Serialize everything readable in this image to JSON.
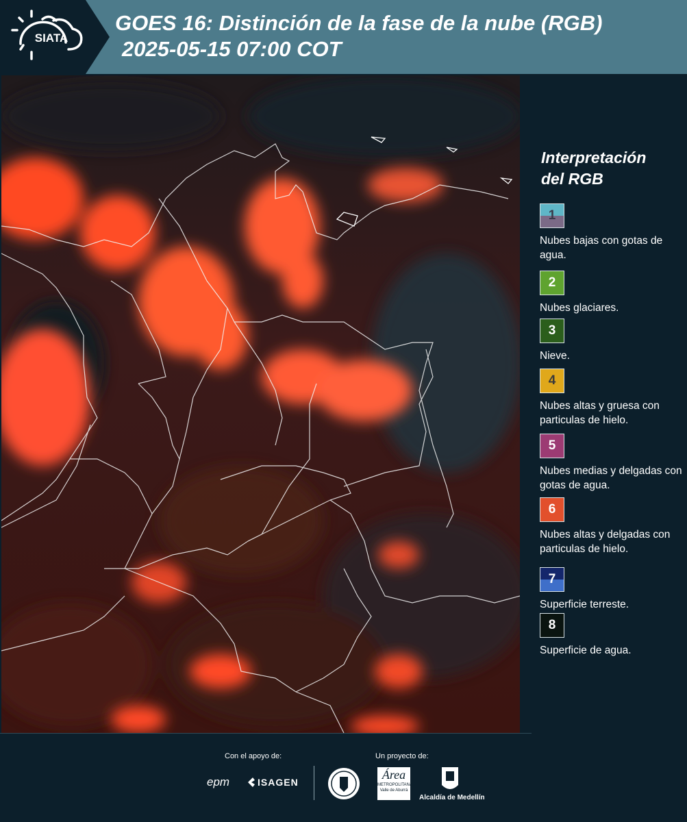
{
  "header": {
    "logo_text": "SIATA",
    "title_line1": "GOES 16: Distinción de la fase de la nube (RGB)",
    "title_line2": "2025-05-15 07:00 COT"
  },
  "legend": {
    "title_line1": "Interpretación",
    "title_line2": "del RGB",
    "items": [
      {
        "num": "1",
        "label": "Nubes bajas con gotas de agua.",
        "color_top": "#5fb6c7",
        "color_bottom": "#7b6a87",
        "text_color": "#3a3a4a"
      },
      {
        "num": "2",
        "label": "Nubes glaciares.",
        "color_top": "#5fa32f",
        "color_bottom": "#5fa32f",
        "text_color": "#ffffff"
      },
      {
        "num": "3",
        "label": "Nieve.",
        "color_top": "#2b5e1c",
        "color_bottom": "#2b5e1c",
        "text_color": "#ffffff"
      },
      {
        "num": "4",
        "label": "Nubes altas y gruesa con particulas de hielo.",
        "color_top": "#e0a81b",
        "color_bottom": "#e0a81b",
        "text_color": "#3a3a3a"
      },
      {
        "num": "5",
        "label": "Nubes medias y delgadas con gotas de agua.",
        "color_top": "#9c3b73",
        "color_bottom": "#9c3b73",
        "text_color": "#ffffff"
      },
      {
        "num": "6",
        "label": "Nubes altas y delgadas con particulas de hielo.",
        "color_top": "#e2502c",
        "color_bottom": "#e2502c",
        "text_color": "#ffffff"
      },
      {
        "num": "7",
        "label": "Superficie terreste.",
        "color_top": "#14266b",
        "color_bottom": "#3f6fc9",
        "text_color": "#ffffff"
      },
      {
        "num": "8",
        "label": "Superficie de agua.",
        "color_top": "#0a1410",
        "color_bottom": "#0a1410",
        "text_color": "#ffffff"
      }
    ]
  },
  "footer": {
    "support_label": "Con el apoyo de:",
    "project_label": "Un proyecto de:",
    "sponsor1": "epm",
    "sponsor2": "ISAGEN",
    "partner_area_line1": "Área",
    "partner_area_line2": "METROPOLITANA",
    "partner_area_line3": "Valle de Aburrá",
    "partner_alcaldia": "Alcaldía de Medellín"
  }
}
